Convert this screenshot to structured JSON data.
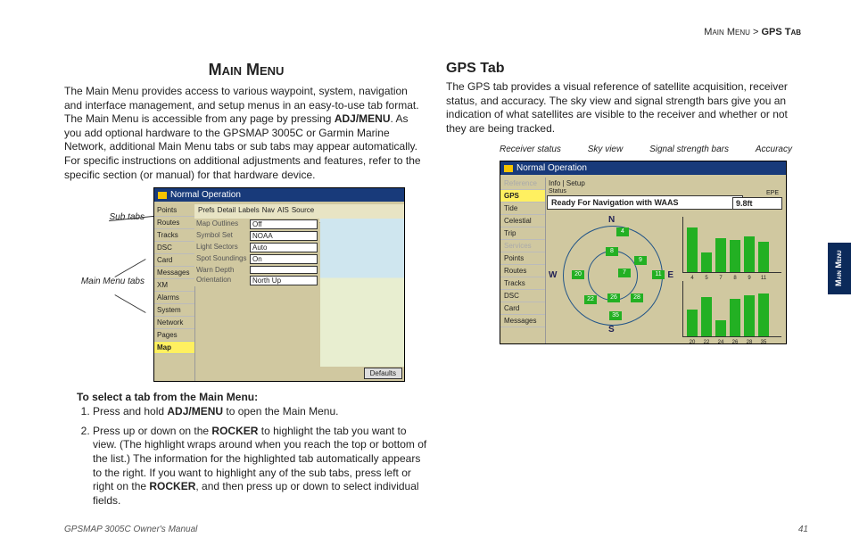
{
  "breadcrumb": {
    "path1": "Main Menu",
    "sep": " > ",
    "path2": "GPS Tab"
  },
  "side_tab": "Main Menu",
  "left": {
    "heading": "Main Menu",
    "para_a": "The Main Menu provides access to various waypoint, system, navigation and interface management, and setup menus in an easy-to-use tab format. The Main Menu is accessible from any page by pressing ",
    "para_b": "ADJ/MENU",
    "para_c": ". As you add optional hardware to the GPSMAP 3005C or Garmin Marine Network, additional Main Menu tabs or sub tabs may appear automatically. For specific instructions on additional adjustments and features, refer to the specific section (or manual) for that hardware device.",
    "callout_subtabs": "Sub tabs",
    "callout_mmtabs": "Main Menu tabs",
    "fig1": {
      "title": "Normal Operation",
      "subtabs": [
        "Prefs",
        "Detail",
        "Labels",
        "Nav",
        "AIS",
        "Source"
      ],
      "side": [
        "Points",
        "Routes",
        "Tracks",
        "DSC",
        "Card",
        "Messages",
        "XM",
        "Alarms",
        "System",
        "Network",
        "Pages",
        "Map"
      ],
      "side_selected": "Map",
      "opts": [
        {
          "lab": "Map Outlines",
          "val": "Off"
        },
        {
          "lab": "Symbol Set",
          "val": "NOAA"
        },
        {
          "lab": "Light Sectors",
          "val": "Auto"
        },
        {
          "lab": "Spot Soundings",
          "val": "On"
        },
        {
          "lab": "Warn Depth",
          "val": ""
        },
        {
          "lab": "Orientation",
          "val": "North Up"
        }
      ],
      "defaults": "Defaults"
    },
    "howto_h": "To select a tab from the Main Menu:",
    "step1_a": "Press and hold ",
    "step1_b": "ADJ/MENU",
    "step1_c": " to open the Main Menu.",
    "step2_a": "Press up or down on the ",
    "step2_b": "ROCKER",
    "step2_c": " to highlight the tab you want to view. (The highlight wraps around when you reach the top or bottom of the list.) The information for the highlighted tab automatically appears to the right. If you want to highlight any of the sub tabs, press left or right on the ",
    "step2_d": "ROCKER",
    "step2_e": ", and then press up or down to select individual fields."
  },
  "right": {
    "heading": "GPS Tab",
    "para": "The GPS tab provides a visual reference of satellite acquisition, receiver status, and accuracy. The sky view and signal strength bars give you an indication of what satellites are visible to the receiver and whether or not they are being tracked.",
    "labels": {
      "a": "Receiver status",
      "b": "Sky view",
      "c": "Signal strength bars",
      "d": "Accuracy"
    },
    "fig2": {
      "title": "Normal Operation",
      "subtabs": "Info | Setup",
      "status_lab": "Status",
      "status": "Ready For Navigation with WAAS",
      "epe_lab": "EPE",
      "epe_val": "9.8ft",
      "side": [
        "Reference",
        "GPS",
        "Tide",
        "Celestial",
        "Trip",
        "Services",
        "Points",
        "Routes",
        "Tracks",
        "DSC",
        "Card",
        "Messages"
      ],
      "side_selected": "GPS",
      "compass": {
        "n": "N",
        "e": "E",
        "s": "S",
        "w": "W"
      },
      "sats": [
        "4",
        "8",
        "9",
        "11",
        "7",
        "20",
        "22",
        "26",
        "28",
        "35"
      ],
      "bars_top": {
        "labels": [
          "4",
          "5",
          "7",
          "8",
          "9",
          "11"
        ],
        "heights": [
          50,
          22,
          38,
          36,
          40,
          34
        ]
      },
      "bars_bot": {
        "labels": [
          "20",
          "22",
          "24",
          "26",
          "28",
          "35"
        ],
        "heights": [
          30,
          44,
          18,
          42,
          46,
          48
        ]
      }
    }
  },
  "footer": {
    "manual": "GPSMAP 3005C Owner's Manual",
    "page": "41"
  }
}
